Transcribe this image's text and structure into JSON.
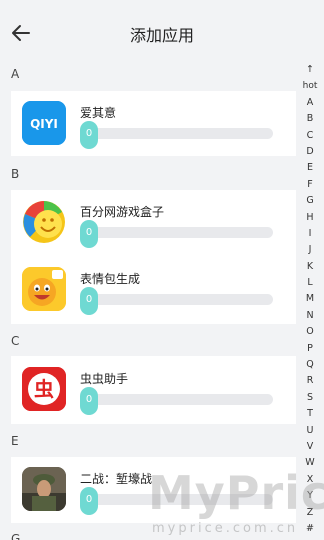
{
  "header": {
    "title": "添加应用",
    "back_icon": "arrow-left-icon"
  },
  "sections": [
    {
      "letter": "A",
      "apps": [
        {
          "name": "爱其意",
          "icon": "iqiyi-icon",
          "icon_text": "QIYI",
          "progress": 0,
          "progress_label": "0"
        }
      ]
    },
    {
      "letter": "B",
      "apps": [
        {
          "name": "百分网游戏盒子",
          "icon": "game-box-icon",
          "progress": 0,
          "progress_label": "0"
        },
        {
          "name": "表情包生成",
          "icon": "emoji-maker-icon",
          "progress": 0,
          "progress_label": "0"
        }
      ]
    },
    {
      "letter": "C",
      "apps": [
        {
          "name": "虫虫助手",
          "icon": "chongchong-icon",
          "icon_text": "虫",
          "progress": 0,
          "progress_label": "0"
        }
      ]
    },
    {
      "letter": "E",
      "apps": [
        {
          "name": "二战：堑壕战",
          "icon": "ww2-soldier-icon",
          "progress": 0,
          "progress_label": "0"
        }
      ]
    },
    {
      "letter": "G",
      "apps": []
    }
  ],
  "index_bar": {
    "up_arrow": "↑",
    "items": [
      "hot",
      "A",
      "B",
      "C",
      "D",
      "E",
      "F",
      "G",
      "H",
      "I",
      "J",
      "K",
      "L",
      "M",
      "N",
      "O",
      "P",
      "Q",
      "R",
      "S",
      "T",
      "U",
      "V",
      "W",
      "X",
      "Y",
      "Z",
      "#"
    ]
  },
  "watermark": {
    "main": "MyPrice",
    "sub": "myprice.com.cn"
  },
  "colors": {
    "background": "#f2f3f5",
    "card": "#ffffff",
    "progress_knob": "#6fd9d2",
    "progress_track": "#e8e9ec"
  }
}
